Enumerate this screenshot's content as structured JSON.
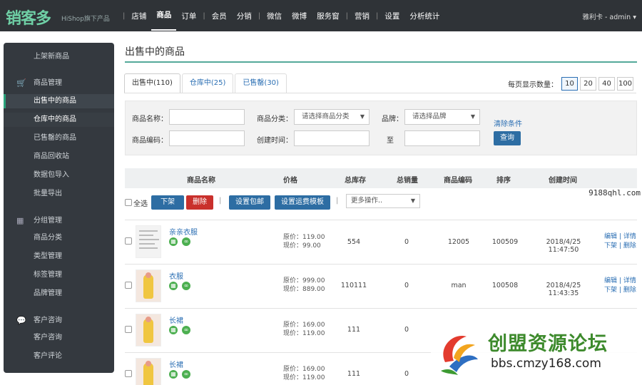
{
  "app": {
    "logo": "销客多",
    "logo_sub": "HiShop旗下产品",
    "user": "雅利卡 - admin ▾"
  },
  "nav": [
    {
      "label": "店铺"
    },
    {
      "label": "商品",
      "active": true
    },
    {
      "label": "订单"
    },
    {
      "label": "会员"
    },
    {
      "label": "分销"
    },
    {
      "label": "微信"
    },
    {
      "label": "微博"
    },
    {
      "label": "服务窗"
    },
    {
      "label": "营销"
    },
    {
      "label": "设置"
    },
    {
      "label": "分析统计"
    }
  ],
  "sidebar": {
    "top_item": "上架新商品",
    "sections": [
      {
        "title": "商品管理",
        "icon": "cart-icon",
        "items": [
          "出售中的商品",
          "仓库中的商品",
          "已售罄的商品",
          "商品回收站",
          "数据包导入",
          "批量导出"
        ]
      },
      {
        "title": "分组管理",
        "icon": "grid-icon",
        "items": [
          "商品分类",
          "类型管理",
          "标签管理",
          "品牌管理"
        ]
      },
      {
        "title": "客户咨询",
        "icon": "chat-icon",
        "items": [
          "客户咨询",
          "客户评论"
        ]
      }
    ]
  },
  "page": {
    "title": "出售中的商品"
  },
  "tabs": [
    {
      "label": "出售中(110)",
      "active": true
    },
    {
      "label": "仓库中(25)"
    },
    {
      "label": "已售罄(30)"
    }
  ],
  "per_page": {
    "label": "每页显示数量：",
    "options": [
      "10",
      "20",
      "40",
      "100"
    ],
    "selected": "10"
  },
  "filter": {
    "name_label": "商品名称：",
    "category_label": "商品分类：",
    "category_value": "请选择商品分类",
    "brand_label": "品牌：",
    "brand_value": "请选择品牌",
    "clear": "清除条件",
    "code_label": "商品编码：",
    "time_label": "创建时间：",
    "to_label": "至",
    "query": "查询"
  },
  "table": {
    "headers": [
      "商品名称",
      "价格",
      "总库存",
      "总销量",
      "商品编码",
      "排序",
      "创建时间"
    ],
    "select_all": "全选",
    "actions": {
      "off": "下架",
      "delete": "删除",
      "set_free_ship": "设置包邮",
      "set_ship_template": "设置运费模板",
      "more": "更多操作.."
    },
    "rows": [
      {
        "name": "亲亲衣服",
        "orig": "原价：119.00",
        "now": "现价：99.00",
        "stock": "554",
        "sales": "0",
        "code": "12005",
        "sort": "100509",
        "created": "2018/4/25 11:47:50",
        "thumb": "doc"
      },
      {
        "name": "衣服",
        "orig": "原价：999.00",
        "now": "现价：889.00",
        "stock": "110111",
        "sales": "0",
        "code": "man",
        "sort": "100508",
        "created": "2018/4/25 11:43:35",
        "thumb": "dress"
      },
      {
        "name": "长裙",
        "orig": "原价：169.00",
        "now": "现价：119.00",
        "stock": "111",
        "sales": "0",
        "code": "",
        "sort": "",
        "created": "",
        "thumb": "dress"
      },
      {
        "name": "长裙",
        "orig": "原价：169.00",
        "now": "现价：119.00",
        "stock": "111",
        "sales": "0",
        "code": "",
        "sort": "",
        "created": "",
        "thumb": "dress"
      }
    ],
    "ops": {
      "edit": "编辑",
      "detail": "详情",
      "off": "下架",
      "delete": "删除",
      "sep": "|"
    }
  },
  "overlay": {
    "watermark": "9188qhl.com",
    "ad_title": "创盟资源论坛",
    "ad_url": "bbs.cmzy168.com"
  }
}
